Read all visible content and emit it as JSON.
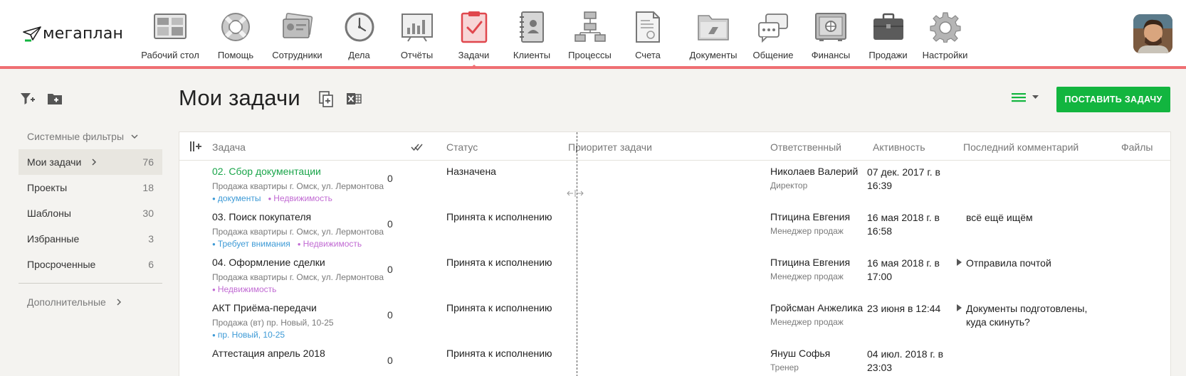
{
  "app": {
    "logo_text": "мегаплан"
  },
  "nav": {
    "items": [
      {
        "label": "Рабочий стол",
        "icon": "desktop-icon",
        "active": false
      },
      {
        "label": "Помощь",
        "icon": "lifebuoy-icon",
        "active": false
      },
      {
        "label": "Сотрудники",
        "icon": "employee-cards-icon",
        "active": false
      },
      {
        "label": "Дела",
        "icon": "clock-icon",
        "active": false
      },
      {
        "label": "Отчёты",
        "icon": "report-chart-icon",
        "active": false
      },
      {
        "label": "Задачи",
        "icon": "task-clipboard-icon",
        "active": true
      },
      {
        "label": "Клиенты",
        "icon": "address-book-icon",
        "active": false
      },
      {
        "label": "Процессы",
        "icon": "process-flow-icon",
        "active": false
      },
      {
        "label": "Счета",
        "icon": "invoice-icon",
        "active": false
      },
      {
        "label": "Документы",
        "icon": "folder-icon",
        "active": false
      },
      {
        "label": "Общение",
        "icon": "chat-bubbles-icon",
        "active": false
      },
      {
        "label": "Финансы",
        "icon": "safe-icon",
        "active": false
      },
      {
        "label": "Продажи",
        "icon": "briefcase-icon",
        "active": false
      },
      {
        "label": "Настройки",
        "icon": "gear-icon",
        "active": false
      }
    ],
    "accent_color": "#ef6f73"
  },
  "sidebar": {
    "system_filters_label": "Системные фильтры",
    "items": [
      {
        "label": "Мои задачи",
        "count": "76",
        "active": true
      },
      {
        "label": "Проекты",
        "count": "18",
        "active": false
      },
      {
        "label": "Шаблоны",
        "count": "30",
        "active": false
      },
      {
        "label": "Избранные",
        "count": "3",
        "active": false
      },
      {
        "label": "Просроченные",
        "count": "6",
        "active": false
      }
    ],
    "extra_label": "Дополнительные"
  },
  "page": {
    "title": "Мои задачи",
    "primary_button": "ПОСТАВИТЬ ЗАДАЧУ",
    "primary_color": "#12b53f"
  },
  "table": {
    "headers": {
      "task": "Задача",
      "status": "Статус",
      "priority": "Приоритет задачи",
      "responsible": "Ответственный",
      "activity": "Активность",
      "last_comment": "Последний комментарий",
      "files": "Файлы"
    },
    "rows": [
      {
        "title": "02. Сбор документации",
        "title_is_link": true,
        "subtitle": "Продажа квартиры г. Омск, ул. Лермонтова",
        "tags": [
          {
            "text": "документы",
            "color": "blue"
          },
          {
            "text": "Недвижимость",
            "color": "purple"
          }
        ],
        "count": "0",
        "status": "Назначена",
        "responsible_name": "Николаев Валерий",
        "responsible_role": "Директор",
        "activity": "07 дек. 2017 г. в 16:39",
        "comment": "",
        "comment_has_arrow": false
      },
      {
        "title": "03. Поиск покупателя",
        "title_is_link": false,
        "subtitle": "Продажа квартиры г. Омск, ул. Лермонтова",
        "tags": [
          {
            "text": "Требует внимания",
            "color": "blue"
          },
          {
            "text": "Недвижимость",
            "color": "purple"
          }
        ],
        "count": "0",
        "status": "Принята к исполнению",
        "responsible_name": "Птицина Евгения",
        "responsible_role": "Менеджер продаж",
        "activity": "16 мая 2018 г. в 16:58",
        "comment": "всё ещё ищём",
        "comment_has_arrow": false
      },
      {
        "title": "04. Оформление сделки",
        "title_is_link": false,
        "subtitle": "Продажа квартиры г. Омск, ул. Лермонтова",
        "tags": [
          {
            "text": "Недвижимость",
            "color": "purple"
          }
        ],
        "count": "0",
        "status": "Принята к исполнению",
        "responsible_name": "Птицина Евгения",
        "responsible_role": "Менеджер продаж",
        "activity": "16 мая 2018 г. в 17:00",
        "comment": "Отправила почтой",
        "comment_has_arrow": true
      },
      {
        "title": "АКТ Приёма-передачи",
        "title_is_link": false,
        "subtitle": "Продажа (вт) пр. Новый, 10-25",
        "tags": [
          {
            "text": "пр. Новый, 10-25",
            "color": "blue"
          }
        ],
        "count": "0",
        "status": "Принята к исполнению",
        "responsible_name": "Гройсман Анжелика",
        "responsible_role": "Менеджер продаж",
        "activity": "23 июня в 12:44",
        "comment": "Документы подготовлены, куда скинуть?",
        "comment_has_arrow": true
      },
      {
        "title": "Аттестация апрель 2018",
        "title_is_link": false,
        "subtitle": "",
        "tags": [],
        "count": "0",
        "status": "Принята к исполнению",
        "responsible_name": "Януш Софья",
        "responsible_role": "Тренер",
        "activity": "04 июл. 2018 г. в 23:03",
        "comment": "",
        "comment_has_arrow": false
      }
    ]
  }
}
